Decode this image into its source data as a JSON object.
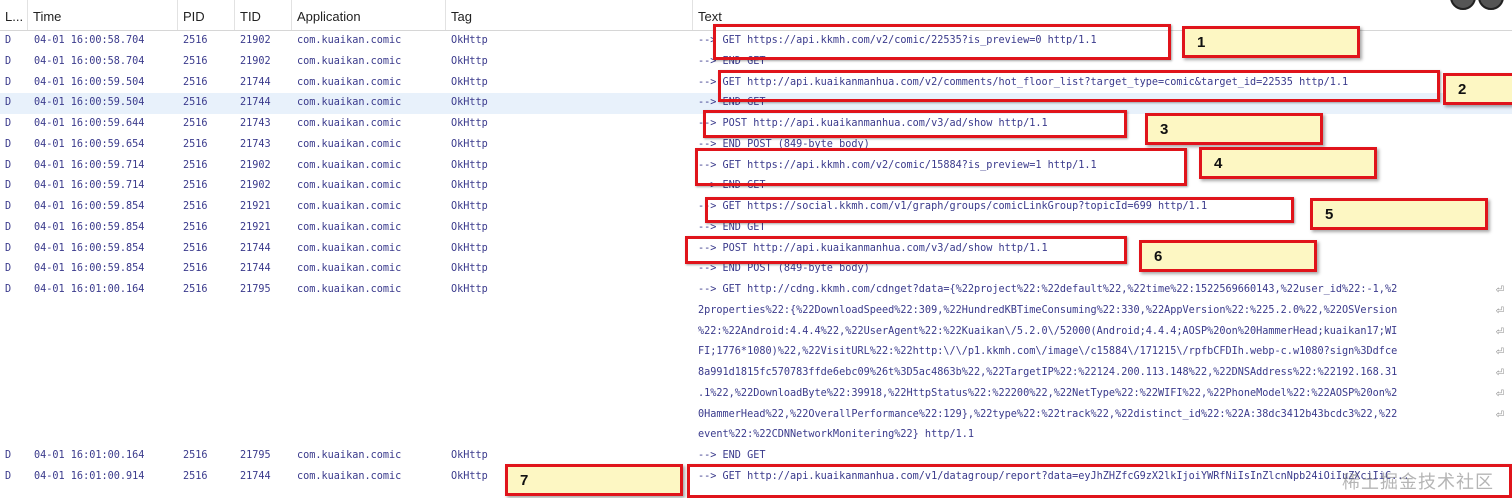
{
  "columns": {
    "level": "L...",
    "time": "Time",
    "pid": "PID",
    "tid": "TID",
    "application": "Application",
    "tag": "Tag",
    "text": "Text"
  },
  "rows": [
    {
      "level": "D",
      "time": "04-01 16:00:58.704",
      "pid": "2516",
      "tid": "21902",
      "app": "com.kuaikan.comic",
      "tag": "OkHttp",
      "text": "--> GET https://api.kkmh.com/v2/comic/22535?is_preview=0 http/1.1"
    },
    {
      "level": "D",
      "time": "04-01 16:00:58.704",
      "pid": "2516",
      "tid": "21902",
      "app": "com.kuaikan.comic",
      "tag": "OkHttp",
      "text": "--> END GET"
    },
    {
      "level": "D",
      "time": "04-01 16:00:59.504",
      "pid": "2516",
      "tid": "21744",
      "app": "com.kuaikan.comic",
      "tag": "OkHttp",
      "text": "--> GET http://api.kuaikanmanhua.com/v2/comments/hot_floor_list?target_type=comic&target_id=22535 http/1.1"
    },
    {
      "level": "D",
      "time": "04-01 16:00:59.504",
      "pid": "2516",
      "tid": "21744",
      "app": "com.kuaikan.comic",
      "tag": "OkHttp",
      "text": "--> END GET"
    },
    {
      "level": "D",
      "time": "04-01 16:00:59.644",
      "pid": "2516",
      "tid": "21743",
      "app": "com.kuaikan.comic",
      "tag": "OkHttp",
      "text": "--> POST http://api.kuaikanmanhua.com/v3/ad/show http/1.1"
    },
    {
      "level": "D",
      "time": "04-01 16:00:59.654",
      "pid": "2516",
      "tid": "21743",
      "app": "com.kuaikan.comic",
      "tag": "OkHttp",
      "text": "--> END POST (849-byte body)"
    },
    {
      "level": "D",
      "time": "04-01 16:00:59.714",
      "pid": "2516",
      "tid": "21902",
      "app": "com.kuaikan.comic",
      "tag": "OkHttp",
      "text": "--> GET https://api.kkmh.com/v2/comic/15884?is_preview=1 http/1.1"
    },
    {
      "level": "D",
      "time": "04-01 16:00:59.714",
      "pid": "2516",
      "tid": "21902",
      "app": "com.kuaikan.comic",
      "tag": "OkHttp",
      "text": "--> END GET"
    },
    {
      "level": "D",
      "time": "04-01 16:00:59.854",
      "pid": "2516",
      "tid": "21921",
      "app": "com.kuaikan.comic",
      "tag": "OkHttp",
      "text": "--> GET https://social.kkmh.com/v1/graph/groups/comicLinkGroup?topicId=699 http/1.1"
    },
    {
      "level": "D",
      "time": "04-01 16:00:59.854",
      "pid": "2516",
      "tid": "21921",
      "app": "com.kuaikan.comic",
      "tag": "OkHttp",
      "text": "--> END GET"
    },
    {
      "level": "D",
      "time": "04-01 16:00:59.854",
      "pid": "2516",
      "tid": "21744",
      "app": "com.kuaikan.comic",
      "tag": "OkHttp",
      "text": "--> POST http://api.kuaikanmanhua.com/v3/ad/show http/1.1"
    },
    {
      "level": "D",
      "time": "04-01 16:00:59.854",
      "pid": "2516",
      "tid": "21744",
      "app": "com.kuaikan.comic",
      "tag": "OkHttp",
      "text": "--> END POST (849-byte body)"
    },
    {
      "level": "D",
      "time": "04-01 16:01:00.164",
      "pid": "2516",
      "tid": "21795",
      "app": "com.kuaikan.comic",
      "tag": "OkHttp",
      "text": "--> GET http://cdng.kkmh.com/cdnget?data={%22project%22:%22default%22,%22time%22:1522569660143,%22user_id%22:-1,%2"
    },
    {
      "level": "",
      "time": "",
      "pid": "",
      "tid": "",
      "app": "",
      "tag": "",
      "text": "2properties%22:{%22DownloadSpeed%22:309,%22HundredKBTimeConsuming%22:330,%22AppVersion%22:%225.2.0%22,%22OSVersion"
    },
    {
      "level": "",
      "time": "",
      "pid": "",
      "tid": "",
      "app": "",
      "tag": "",
      "text": "%22:%22Android:4.4.4%22,%22UserAgent%22:%22Kuaikan\\/5.2.0\\/52000(Android;4.4.4;AOSP%20on%20HammerHead;kuaikan17;WI"
    },
    {
      "level": "",
      "time": "",
      "pid": "",
      "tid": "",
      "app": "",
      "tag": "",
      "text": "FI;1776*1080)%22,%22VisitURL%22:%22http:\\/\\/p1.kkmh.com\\/image\\/c15884\\/171215\\/rpfbCFDIh.webp-c.w1080?sign%3Ddfce"
    },
    {
      "level": "",
      "time": "",
      "pid": "",
      "tid": "",
      "app": "",
      "tag": "",
      "text": "8a991d1815fc570783ffde6ebc09%26t%3D5ac4863b%22,%22TargetIP%22:%22124.200.113.148%22,%22DNSAddress%22:%22192.168.31"
    },
    {
      "level": "",
      "time": "",
      "pid": "",
      "tid": "",
      "app": "",
      "tag": "",
      "text": ".1%22,%22DownloadByte%22:39918,%22HttpStatus%22:%22200%22,%22NetType%22:%22WIFI%22,%22PhoneModel%22:%22AOSP%20on%2"
    },
    {
      "level": "",
      "time": "",
      "pid": "",
      "tid": "",
      "app": "",
      "tag": "",
      "text": "0HammerHead%22,%22OverallPerformance%22:129},%22type%22:%22track%22,%22distinct_id%22:%22A:38dc3412b43bcdc3%22,%22"
    },
    {
      "level": "",
      "time": "",
      "pid": "",
      "tid": "",
      "app": "",
      "tag": "",
      "text": "event%22:%22CDNNetworkMonitering%22} http/1.1"
    },
    {
      "level": "D",
      "time": "04-01 16:01:00.164",
      "pid": "2516",
      "tid": "21795",
      "app": "com.kuaikan.comic",
      "tag": "OkHttp",
      "text": "--> END GET"
    },
    {
      "level": "D",
      "time": "04-01 16:01:00.914",
      "pid": "2516",
      "tid": "21744",
      "app": "com.kuaikan.comic",
      "tag": "OkHttp",
      "text": "--> GET http://api.kuaikanmanhua.com/v1/datagroup/report?data=eyJhZHZfcG9zX2lkIjoiYWRfNiIsInZlcnNpb24iOiIuZXciIiC..."
    }
  ],
  "selected_row": 3,
  "wrapped_rows": [
    12,
    13,
    14,
    15,
    16,
    17,
    18
  ],
  "annotations": [
    {
      "label": "1"
    },
    {
      "label": "2"
    },
    {
      "label": "3"
    },
    {
      "label": "4"
    },
    {
      "label": "5"
    },
    {
      "label": "6"
    },
    {
      "label": "7"
    }
  ],
  "icons": {
    "wrap": "soft-wrap-icon"
  },
  "watermark": "稀土掘金技术社区",
  "colors": {
    "highlight": "#e0141b",
    "note_bg": "#fdf7c3",
    "text": "#3a3a8c",
    "selected_bg": "#e8f1fb"
  }
}
